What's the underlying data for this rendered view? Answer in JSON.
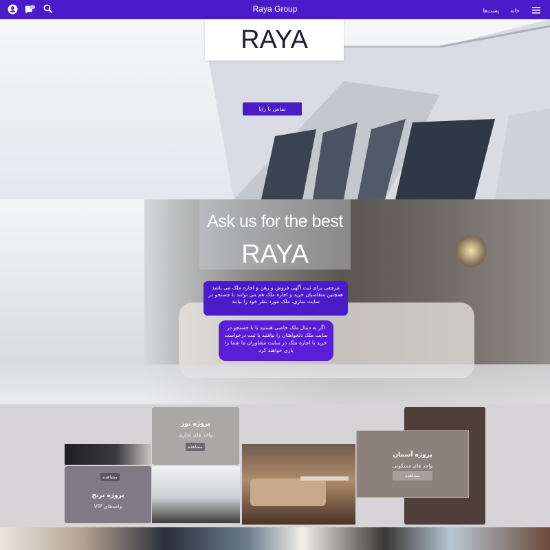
{
  "header": {
    "title": "Raya Group",
    "nav": [
      "خانه",
      "پست‌ها"
    ],
    "icons": [
      "account-icon",
      "chat-icon",
      "search-icon",
      "menu-icon"
    ]
  },
  "hero": {
    "logo_text": "RAYA",
    "contact_button": "تماس با رایا"
  },
  "promo": {
    "headline": "Ask us for the best",
    "logo_text": "RAYA",
    "bubble1": "مرجعی برای ثبت آگهی فروش و رهن و اجاره ملک می باشد همچنین متقاضیان خرید و اجاره ملک هم می توانند با جستجو در سایت سازی، ملک مورد نظر خود را بیابند",
    "bubble2": "اگر به دنبال ملک خاصی هستید یا با جستجو در سایت ملک دلخواهتان را نیافتید با ثبت درخواست خرید یا اجاره ملک در سایت مشاوران ما شما را یاری خواهند کرد"
  },
  "projects": [
    {
      "title": "پروژه نور",
      "subtitle": "واحد های تجاری",
      "button": "مشاهده"
    },
    {
      "title": "پروژه ترنج",
      "subtitle": "واحدهای VIP",
      "button": "مشاهده"
    },
    {
      "title": "پروژه آسمان",
      "subtitle": "واحد های مسکونی",
      "button": "مشاهده"
    }
  ],
  "colors": {
    "brand": "#4a1bc9",
    "bubble": "#5a1ed6",
    "section_bg": "#d6d4d7"
  }
}
